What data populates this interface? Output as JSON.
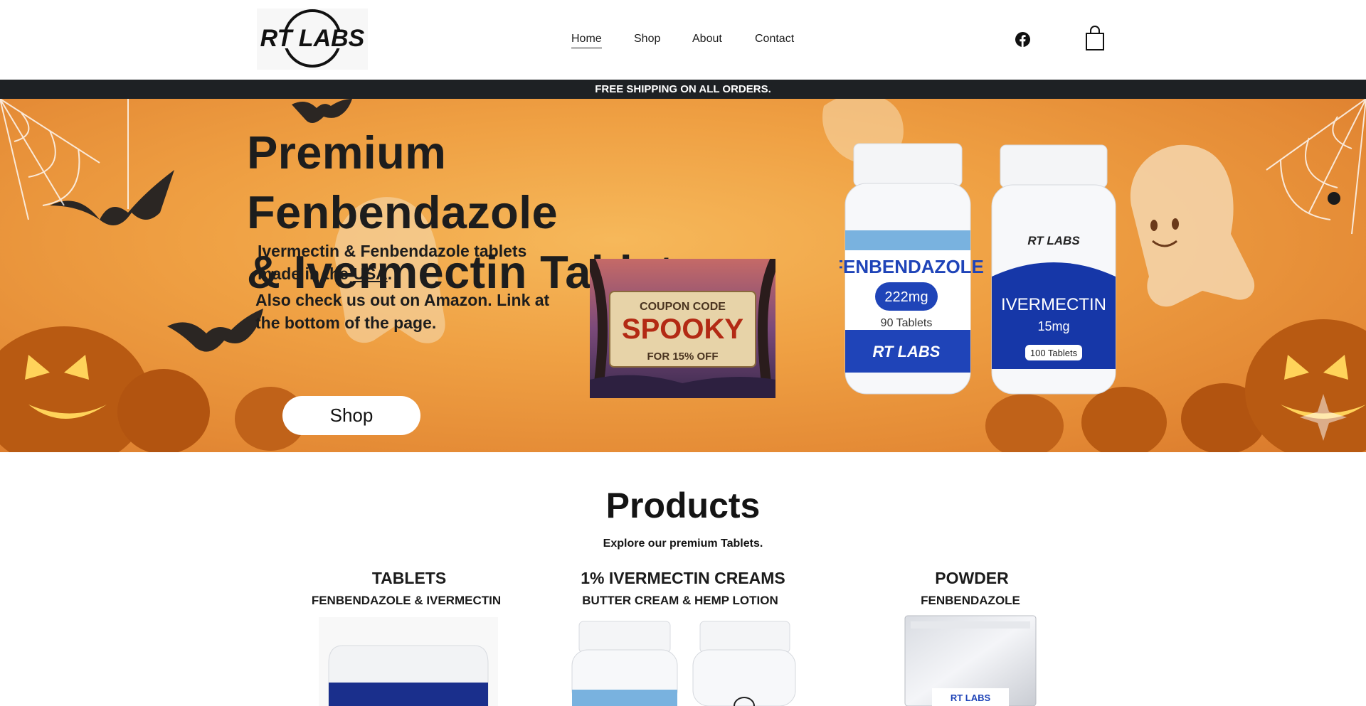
{
  "header": {
    "logo_text": "RT LABS",
    "nav": [
      {
        "label": "Home",
        "active": true
      },
      {
        "label": "Shop",
        "active": false
      },
      {
        "label": "About",
        "active": false
      },
      {
        "label": "Contact",
        "active": false
      }
    ],
    "icons": [
      "facebook-icon",
      "shopping-bag-icon"
    ]
  },
  "announcement": "FREE SHIPPING ON ALL ORDERS.",
  "hero": {
    "title_line1": "Premium Fenbendazole",
    "title_line2": "& Ivermectin Tablets",
    "sub1_line1": "Ivermectin & Fenbendazole tablets",
    "sub1_line2_pre": "made in the ",
    "sub1_link": "USA",
    "sub1_line2_post": ".",
    "sub2": "Also check us out on Amazon. Link at the bottom of the page.",
    "shop_button": "Shop",
    "coupon": {
      "line1": "COUPON CODE",
      "code": "SPOOKY",
      "line3": "FOR 15% OFF"
    },
    "bottle_fen": {
      "name": "FENBENDAZOLE",
      "dose": "222mg",
      "count": "90 Tablets",
      "brand": "RT LABS"
    },
    "bottle_iver": {
      "brand": "RT LABS",
      "name": "IVERMECTIN",
      "dose": "15mg",
      "count": "100 Tablets"
    }
  },
  "products": {
    "title": "Products",
    "subtitle": "Explore our premium Tablets.",
    "categories": [
      {
        "title": "TABLETS",
        "subtitle": "FENBENDAZOLE & IVERMECTIN"
      },
      {
        "title": "1% IVERMECTIN CREAMS",
        "subtitle": "BUTTER CREAM & HEMP LOTION"
      },
      {
        "title": "POWDER",
        "subtitle": "FENBENDAZOLE"
      }
    ],
    "powder_label": "RT LABS"
  },
  "colors": {
    "hero_orange": "#efa043",
    "announce_bg": "#1e2124",
    "fen_blue": "#1f44b8",
    "iver_blue": "#1637a8",
    "light_blue": "#7fb7e3"
  }
}
